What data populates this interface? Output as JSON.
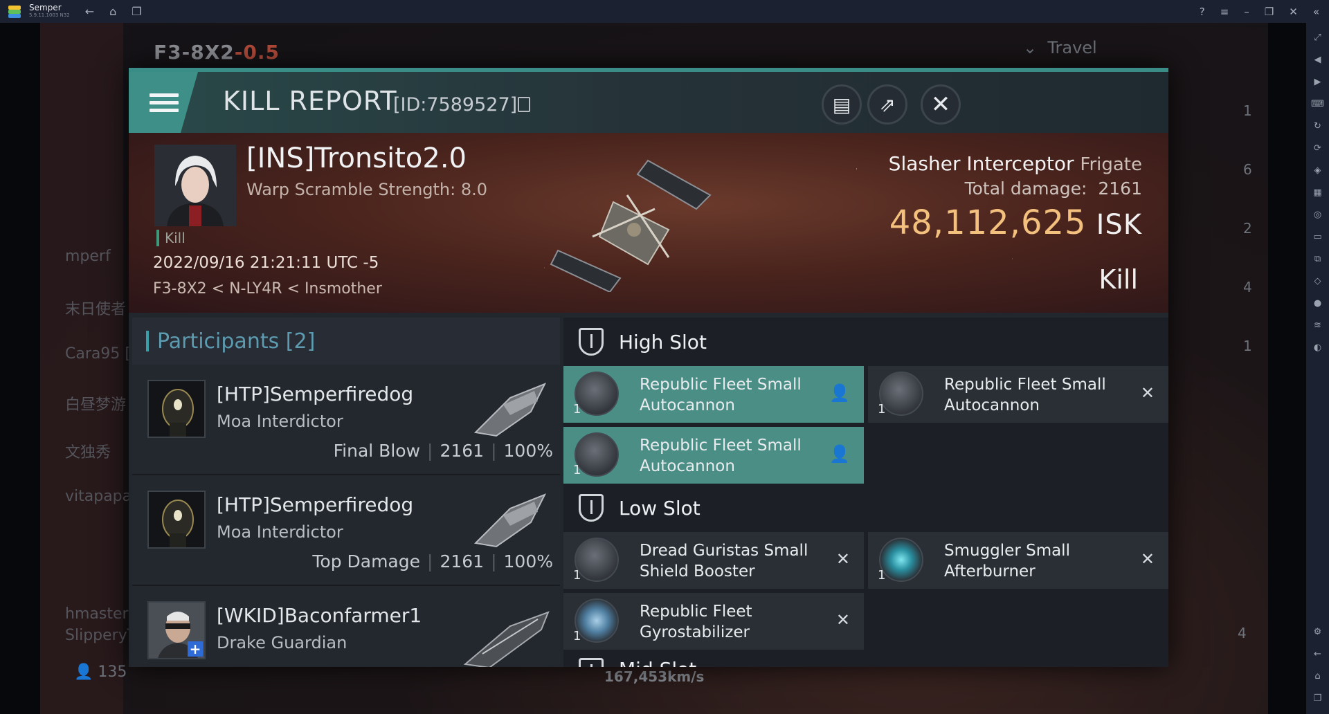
{
  "emulator": {
    "app_name": "Semper",
    "app_version": "5.9.11.1003 N32"
  },
  "game_bg": {
    "system": "F3-8X2",
    "security": "-0.5",
    "travel_label": "Travel",
    "speed": "167,453km/s",
    "crew_count": "135",
    "bg_chat": [
      "mperf",
      "末日使者",
      "Cara95 [",
      "白昼梦游",
      "文独秀",
      "vitapapa",
      "hmaster",
      "SlipperyTh"
    ],
    "right_counts": [
      "1",
      "6",
      "2",
      "4",
      "1",
      "4"
    ]
  },
  "modal": {
    "title": "KILL REPORT",
    "report_id": "[ID:7589527]",
    "buttons": {
      "notes_icon": "clipboard-icon",
      "share_icon": "share-icon",
      "close_icon": "close-icon"
    },
    "victim": {
      "name": "[INS]Tronsito2.0",
      "warp_scramble": "Warp Scramble Strength: 8.0",
      "tag": "Kill",
      "datetime": "2022/09/16 21:21:11 UTC -5",
      "location": "F3-8X2 < N-LY4R < Insmother",
      "ship_name": "Slasher Interceptor",
      "ship_class": "Frigate",
      "total_damage_label": "Total damage:",
      "total_damage": "2161",
      "isk_value": "48,112,625",
      "isk_unit": "ISK",
      "result": "Kill"
    },
    "participants": {
      "title": "Participants",
      "count": "[2]",
      "rows": [
        {
          "name": "[HTP]Semperfiredog",
          "ship": "Moa Interdictor",
          "stat_label": "Final Blow",
          "damage": "2161",
          "percent": "100%"
        },
        {
          "name": "[HTP]Semperfiredog",
          "ship": "Moa Interdictor",
          "stat_label": "Top Damage",
          "damage": "2161",
          "percent": "100%"
        },
        {
          "name": "[WKID]Baconfarmer1",
          "ship": "Drake Guardian",
          "stat_label": "",
          "damage": "",
          "percent": ""
        }
      ]
    },
    "slots": {
      "high_title": "High Slot",
      "low_title": "Low Slot",
      "mid_title": "Mid Slot",
      "high": [
        {
          "name": "Republic Fleet Small Autocannon",
          "qty": "1",
          "status": "fitted"
        },
        {
          "name": "Republic Fleet Small Autocannon",
          "qty": "1",
          "status": "destroyed"
        },
        {
          "name": "Republic Fleet Small Autocannon",
          "qty": "1",
          "status": "fitted"
        }
      ],
      "low": [
        {
          "name": "Dread Guristas Small Shield Booster",
          "qty": "1",
          "status": "destroyed"
        },
        {
          "name": "Smuggler Small Afterburner",
          "qty": "1",
          "status": "destroyed"
        },
        {
          "name": "Republic Fleet Gyrostabilizer",
          "qty": "1",
          "status": "destroyed"
        }
      ]
    }
  },
  "colors": {
    "accent_teal": "#3d8f88",
    "isk_gold": "#f3c17d",
    "security_red": "#b44b3a"
  }
}
